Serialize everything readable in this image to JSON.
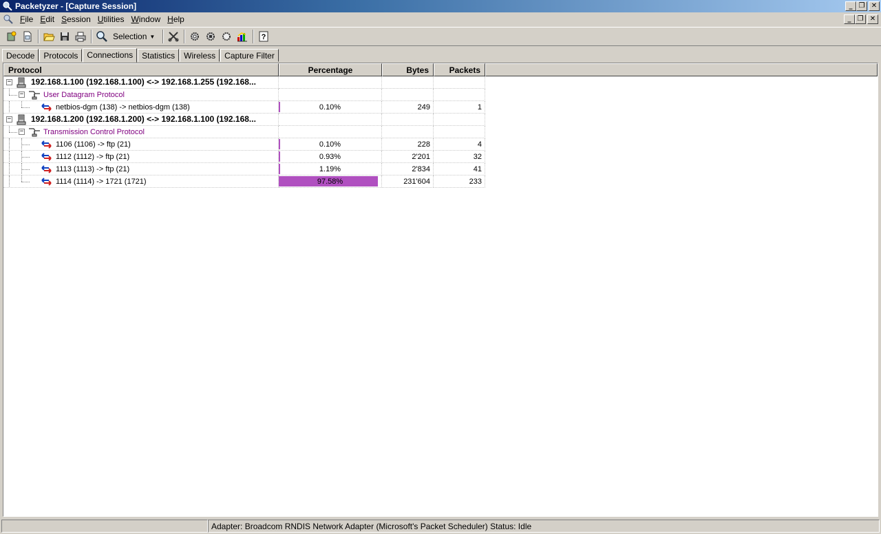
{
  "window": {
    "title": "Packetyzer - [Capture Session]"
  },
  "menu": {
    "items": [
      {
        "key": "F",
        "rest": "ile"
      },
      {
        "key": "E",
        "rest": "dit"
      },
      {
        "key": "S",
        "rest": "ession"
      },
      {
        "key": "U",
        "rest": "tilities"
      },
      {
        "key": "W",
        "rest": "indow"
      },
      {
        "key": "H",
        "rest": "elp"
      }
    ]
  },
  "toolbar": {
    "selection_label": "Selection"
  },
  "tabs": [
    {
      "label": "Decode",
      "active": false
    },
    {
      "label": "Protocols",
      "active": false
    },
    {
      "label": "Connections",
      "active": true
    },
    {
      "label": "Statistics",
      "active": false
    },
    {
      "label": "Wireless",
      "active": false
    },
    {
      "label": "Capture Filter",
      "active": false
    }
  ],
  "table": {
    "headers": {
      "protocol": "Protocol",
      "percentage": "Percentage",
      "bytes": "Bytes",
      "packets": "Packets"
    },
    "rows": [
      {
        "level": 0,
        "kind": "host",
        "label": "192.168.1.100 (192.168.1.100) <-> 192.168.1.255 (192.168...",
        "pct": "",
        "pct_value": 0,
        "bytes": "",
        "packets": ""
      },
      {
        "level": 1,
        "kind": "protocol",
        "label": "User Datagram Protocol",
        "pct": "",
        "pct_value": 0,
        "bytes": "",
        "packets": ""
      },
      {
        "level": 2,
        "kind": "conn",
        "label": "netbios-dgm (138) -> netbios-dgm (138)",
        "pct": "0.10%",
        "pct_value": 0.1,
        "bytes": "249",
        "packets": "1"
      },
      {
        "level": 0,
        "kind": "host",
        "label": "192.168.1.200 (192.168.1.200) <-> 192.168.1.100 (192.168...",
        "pct": "",
        "pct_value": 0,
        "bytes": "",
        "packets": ""
      },
      {
        "level": 1,
        "kind": "protocol",
        "label": "Transmission Control Protocol",
        "pct": "",
        "pct_value": 0,
        "bytes": "",
        "packets": ""
      },
      {
        "level": 2,
        "kind": "conn",
        "label": "1106 (1106) -> ftp (21)",
        "pct": "0.10%",
        "pct_value": 0.1,
        "bytes": "228",
        "packets": "4"
      },
      {
        "level": 2,
        "kind": "conn",
        "label": "1112 (1112) -> ftp (21)",
        "pct": "0.93%",
        "pct_value": 0.93,
        "bytes": "2'201",
        "packets": "32"
      },
      {
        "level": 2,
        "kind": "conn",
        "label": "1113 (1113) -> ftp (21)",
        "pct": "1.19%",
        "pct_value": 1.19,
        "bytes": "2'834",
        "packets": "41"
      },
      {
        "level": 2,
        "kind": "conn",
        "label": "1114 (1114) -> 1721 (1721)",
        "pct": "97.58%",
        "pct_value": 97.58,
        "bytes": "231'604",
        "packets": "233"
      }
    ]
  },
  "status": {
    "panel1": "",
    "panel2": "Adapter: Broadcom RNDIS Network Adapter (Microsoft's Packet Scheduler)   Status: Idle"
  },
  "colors": {
    "bar": "#b050c0",
    "protocol_text": "#800080"
  }
}
